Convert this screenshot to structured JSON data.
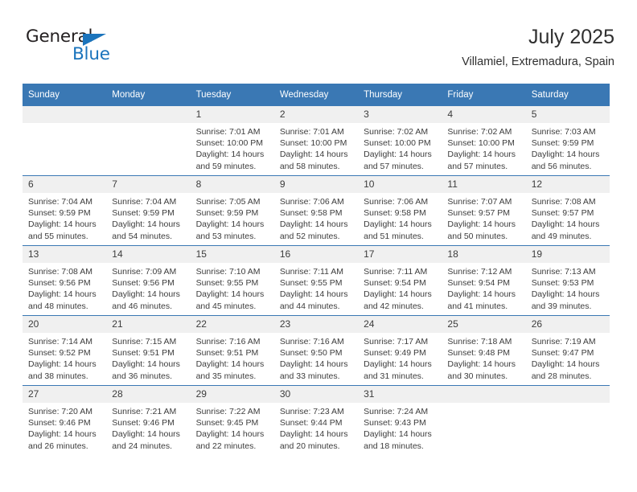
{
  "logo": {
    "word_top": "General",
    "word_bottom": "Blue",
    "triangle_icon": "triangle-icon",
    "brand_color": "#1b74bc",
    "text_color": "#231f20"
  },
  "header": {
    "title": "July 2025",
    "subtitle": "Villamiel, Extremadura, Spain"
  },
  "theme": {
    "header_blue": "#3a78b4",
    "daynum_band": "#f0f0f0",
    "text": "#3c3c3c",
    "page_background": "#ffffff"
  },
  "weekday_headers": [
    "Sunday",
    "Monday",
    "Tuesday",
    "Wednesday",
    "Thursday",
    "Friday",
    "Saturday"
  ],
  "labels": {
    "sunrise_prefix": "Sunrise:",
    "sunset_prefix": "Sunset:",
    "daylight_prefix": "Daylight:"
  },
  "weeks": [
    [
      {
        "day": "",
        "sunrise": "",
        "sunset": "",
        "daylight_l1": "",
        "daylight_l2": ""
      },
      {
        "day": "",
        "sunrise": "",
        "sunset": "",
        "daylight_l1": "",
        "daylight_l2": ""
      },
      {
        "day": "1",
        "sunrise": "Sunrise: 7:01 AM",
        "sunset": "Sunset: 10:00 PM",
        "daylight_l1": "Daylight: 14 hours",
        "daylight_l2": "and 59 minutes."
      },
      {
        "day": "2",
        "sunrise": "Sunrise: 7:01 AM",
        "sunset": "Sunset: 10:00 PM",
        "daylight_l1": "Daylight: 14 hours",
        "daylight_l2": "and 58 minutes."
      },
      {
        "day": "3",
        "sunrise": "Sunrise: 7:02 AM",
        "sunset": "Sunset: 10:00 PM",
        "daylight_l1": "Daylight: 14 hours",
        "daylight_l2": "and 57 minutes."
      },
      {
        "day": "4",
        "sunrise": "Sunrise: 7:02 AM",
        "sunset": "Sunset: 10:00 PM",
        "daylight_l1": "Daylight: 14 hours",
        "daylight_l2": "and 57 minutes."
      },
      {
        "day": "5",
        "sunrise": "Sunrise: 7:03 AM",
        "sunset": "Sunset: 9:59 PM",
        "daylight_l1": "Daylight: 14 hours",
        "daylight_l2": "and 56 minutes."
      }
    ],
    [
      {
        "day": "6",
        "sunrise": "Sunrise: 7:04 AM",
        "sunset": "Sunset: 9:59 PM",
        "daylight_l1": "Daylight: 14 hours",
        "daylight_l2": "and 55 minutes."
      },
      {
        "day": "7",
        "sunrise": "Sunrise: 7:04 AM",
        "sunset": "Sunset: 9:59 PM",
        "daylight_l1": "Daylight: 14 hours",
        "daylight_l2": "and 54 minutes."
      },
      {
        "day": "8",
        "sunrise": "Sunrise: 7:05 AM",
        "sunset": "Sunset: 9:59 PM",
        "daylight_l1": "Daylight: 14 hours",
        "daylight_l2": "and 53 minutes."
      },
      {
        "day": "9",
        "sunrise": "Sunrise: 7:06 AM",
        "sunset": "Sunset: 9:58 PM",
        "daylight_l1": "Daylight: 14 hours",
        "daylight_l2": "and 52 minutes."
      },
      {
        "day": "10",
        "sunrise": "Sunrise: 7:06 AM",
        "sunset": "Sunset: 9:58 PM",
        "daylight_l1": "Daylight: 14 hours",
        "daylight_l2": "and 51 minutes."
      },
      {
        "day": "11",
        "sunrise": "Sunrise: 7:07 AM",
        "sunset": "Sunset: 9:57 PM",
        "daylight_l1": "Daylight: 14 hours",
        "daylight_l2": "and 50 minutes."
      },
      {
        "day": "12",
        "sunrise": "Sunrise: 7:08 AM",
        "sunset": "Sunset: 9:57 PM",
        "daylight_l1": "Daylight: 14 hours",
        "daylight_l2": "and 49 minutes."
      }
    ],
    [
      {
        "day": "13",
        "sunrise": "Sunrise: 7:08 AM",
        "sunset": "Sunset: 9:56 PM",
        "daylight_l1": "Daylight: 14 hours",
        "daylight_l2": "and 48 minutes."
      },
      {
        "day": "14",
        "sunrise": "Sunrise: 7:09 AM",
        "sunset": "Sunset: 9:56 PM",
        "daylight_l1": "Daylight: 14 hours",
        "daylight_l2": "and 46 minutes."
      },
      {
        "day": "15",
        "sunrise": "Sunrise: 7:10 AM",
        "sunset": "Sunset: 9:55 PM",
        "daylight_l1": "Daylight: 14 hours",
        "daylight_l2": "and 45 minutes."
      },
      {
        "day": "16",
        "sunrise": "Sunrise: 7:11 AM",
        "sunset": "Sunset: 9:55 PM",
        "daylight_l1": "Daylight: 14 hours",
        "daylight_l2": "and 44 minutes."
      },
      {
        "day": "17",
        "sunrise": "Sunrise: 7:11 AM",
        "sunset": "Sunset: 9:54 PM",
        "daylight_l1": "Daylight: 14 hours",
        "daylight_l2": "and 42 minutes."
      },
      {
        "day": "18",
        "sunrise": "Sunrise: 7:12 AM",
        "sunset": "Sunset: 9:54 PM",
        "daylight_l1": "Daylight: 14 hours",
        "daylight_l2": "and 41 minutes."
      },
      {
        "day": "19",
        "sunrise": "Sunrise: 7:13 AM",
        "sunset": "Sunset: 9:53 PM",
        "daylight_l1": "Daylight: 14 hours",
        "daylight_l2": "and 39 minutes."
      }
    ],
    [
      {
        "day": "20",
        "sunrise": "Sunrise: 7:14 AM",
        "sunset": "Sunset: 9:52 PM",
        "daylight_l1": "Daylight: 14 hours",
        "daylight_l2": "and 38 minutes."
      },
      {
        "day": "21",
        "sunrise": "Sunrise: 7:15 AM",
        "sunset": "Sunset: 9:51 PM",
        "daylight_l1": "Daylight: 14 hours",
        "daylight_l2": "and 36 minutes."
      },
      {
        "day": "22",
        "sunrise": "Sunrise: 7:16 AM",
        "sunset": "Sunset: 9:51 PM",
        "daylight_l1": "Daylight: 14 hours",
        "daylight_l2": "and 35 minutes."
      },
      {
        "day": "23",
        "sunrise": "Sunrise: 7:16 AM",
        "sunset": "Sunset: 9:50 PM",
        "daylight_l1": "Daylight: 14 hours",
        "daylight_l2": "and 33 minutes."
      },
      {
        "day": "24",
        "sunrise": "Sunrise: 7:17 AM",
        "sunset": "Sunset: 9:49 PM",
        "daylight_l1": "Daylight: 14 hours",
        "daylight_l2": "and 31 minutes."
      },
      {
        "day": "25",
        "sunrise": "Sunrise: 7:18 AM",
        "sunset": "Sunset: 9:48 PM",
        "daylight_l1": "Daylight: 14 hours",
        "daylight_l2": "and 30 minutes."
      },
      {
        "day": "26",
        "sunrise": "Sunrise: 7:19 AM",
        "sunset": "Sunset: 9:47 PM",
        "daylight_l1": "Daylight: 14 hours",
        "daylight_l2": "and 28 minutes."
      }
    ],
    [
      {
        "day": "27",
        "sunrise": "Sunrise: 7:20 AM",
        "sunset": "Sunset: 9:46 PM",
        "daylight_l1": "Daylight: 14 hours",
        "daylight_l2": "and 26 minutes."
      },
      {
        "day": "28",
        "sunrise": "Sunrise: 7:21 AM",
        "sunset": "Sunset: 9:46 PM",
        "daylight_l1": "Daylight: 14 hours",
        "daylight_l2": "and 24 minutes."
      },
      {
        "day": "29",
        "sunrise": "Sunrise: 7:22 AM",
        "sunset": "Sunset: 9:45 PM",
        "daylight_l1": "Daylight: 14 hours",
        "daylight_l2": "and 22 minutes."
      },
      {
        "day": "30",
        "sunrise": "Sunrise: 7:23 AM",
        "sunset": "Sunset: 9:44 PM",
        "daylight_l1": "Daylight: 14 hours",
        "daylight_l2": "and 20 minutes."
      },
      {
        "day": "31",
        "sunrise": "Sunrise: 7:24 AM",
        "sunset": "Sunset: 9:43 PM",
        "daylight_l1": "Daylight: 14 hours",
        "daylight_l2": "and 18 minutes."
      },
      {
        "day": "",
        "sunrise": "",
        "sunset": "",
        "daylight_l1": "",
        "daylight_l2": ""
      },
      {
        "day": "",
        "sunrise": "",
        "sunset": "",
        "daylight_l1": "",
        "daylight_l2": ""
      }
    ]
  ]
}
